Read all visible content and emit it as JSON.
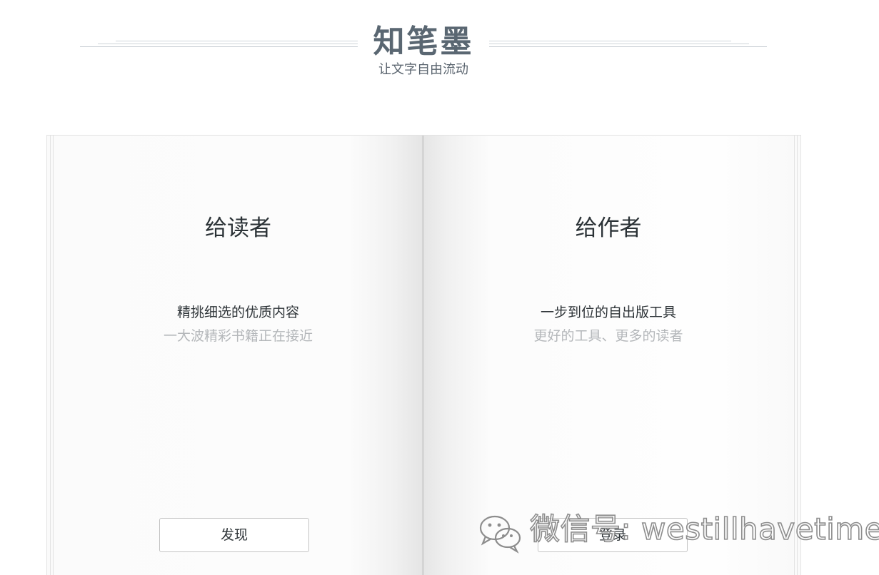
{
  "header": {
    "logo_title": "知笔墨",
    "tagline": "让文字自由流动"
  },
  "readers": {
    "heading": "给读者",
    "line1": "精挑细选的优质内容",
    "line2": "一大波精彩书籍正在接近",
    "button_label": "发现"
  },
  "writers": {
    "heading": "给作者",
    "line1": "一步到位的自出版工具",
    "line2": "更好的工具、更多的读者",
    "button_label": "登录"
  },
  "watermark": {
    "text": "微信号: westillhavetime",
    "icon": "wechat-icon"
  },
  "colors": {
    "logo": "#5a6772",
    "heading_text": "#2b3236",
    "muted_text": "#b4b7ba",
    "rule": "#c7cdd3"
  }
}
